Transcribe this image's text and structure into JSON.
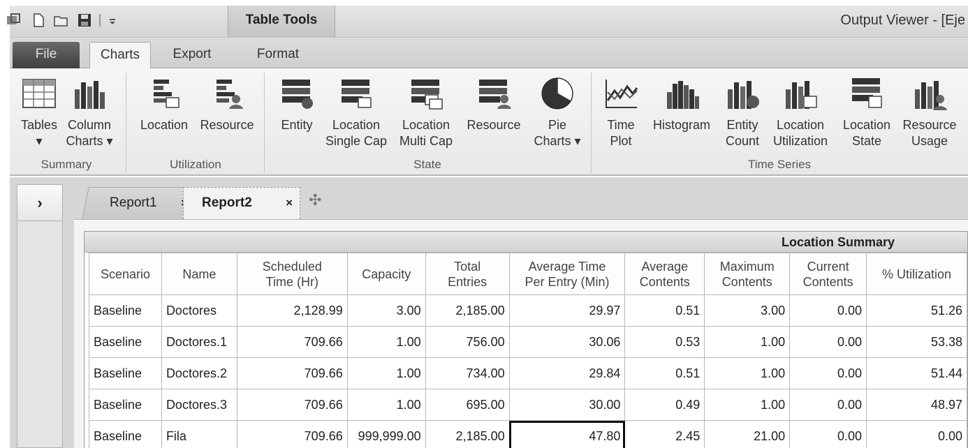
{
  "titlebar": {
    "context_tab": "Table Tools",
    "window_title": "Output Viewer - [Eje"
  },
  "ribbon_tabs": {
    "file": "File",
    "charts": "Charts",
    "export": "Export",
    "format": "Format"
  },
  "ribbon": {
    "summary": {
      "label": "Summary",
      "tables": "Tables",
      "column_charts_1": "Column",
      "column_charts_2": "Charts ▾"
    },
    "utilization": {
      "label": "Utilization",
      "location": "Location",
      "resource": "Resource"
    },
    "state": {
      "label": "State",
      "entity": "Entity",
      "loc_single_1": "Location",
      "loc_single_2": "Single Cap",
      "loc_multi_1": "Location",
      "loc_multi_2": "Multi Cap",
      "resource": "Resource",
      "pie_1": "Pie",
      "pie_2": "Charts ▾"
    },
    "time_series": {
      "label": "Time Series",
      "time_plot_1": "Time",
      "time_plot_2": "Plot",
      "histogram": "Histogram",
      "entity_count_1": "Entity",
      "entity_count_2": "Count",
      "loc_util_1": "Location",
      "loc_util_2": "Utilization",
      "loc_state_1": "Location",
      "loc_state_2": "State",
      "res_usage_1": "Resource",
      "res_usage_2": "Usage"
    }
  },
  "doc_tabs": {
    "report1": "Report1",
    "report2": "Report2",
    "close": "×",
    "expand": "›",
    "new": "✣"
  },
  "table": {
    "title": "Location Summary",
    "headers": [
      [
        "Scenario",
        ""
      ],
      [
        "Name",
        ""
      ],
      [
        "Scheduled",
        "Time (Hr)"
      ],
      [
        "Capacity",
        ""
      ],
      [
        "Total",
        "Entries"
      ],
      [
        "Average Time",
        "Per Entry (Min)"
      ],
      [
        "Average",
        "Contents"
      ],
      [
        "Maximum",
        "Contents"
      ],
      [
        "Current",
        "Contents"
      ],
      [
        "% Utilization",
        ""
      ]
    ],
    "rows": [
      [
        "Baseline",
        "Doctores",
        "2,128.99",
        "3.00",
        "2,185.00",
        "29.97",
        "0.51",
        "3.00",
        "0.00",
        "51.26"
      ],
      [
        "Baseline",
        "Doctores.1",
        "709.66",
        "1.00",
        "756.00",
        "30.06",
        "0.53",
        "1.00",
        "0.00",
        "53.38"
      ],
      [
        "Baseline",
        "Doctores.2",
        "709.66",
        "1.00",
        "734.00",
        "29.84",
        "0.51",
        "1.00",
        "0.00",
        "51.44"
      ],
      [
        "Baseline",
        "Doctores.3",
        "709.66",
        "1.00",
        "695.00",
        "30.00",
        "0.49",
        "1.00",
        "0.00",
        "48.97"
      ],
      [
        "Baseline",
        "Fila",
        "709.66",
        "999,999.00",
        "2,185.00",
        "47.80",
        "2.45",
        "21.00",
        "0.00",
        "0.00"
      ]
    ]
  }
}
